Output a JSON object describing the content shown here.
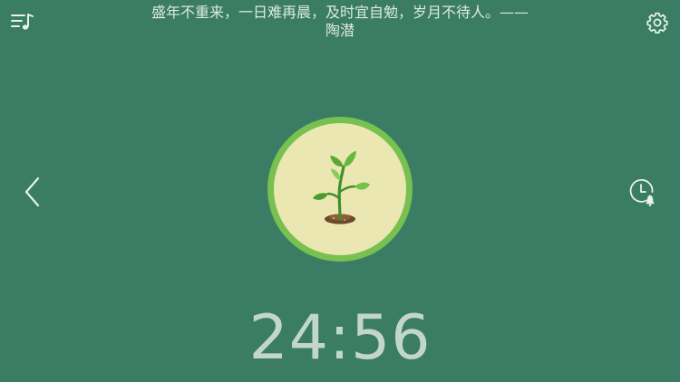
{
  "colors": {
    "background": "#3b7c64",
    "ring": "#78c04f",
    "circle_fill": "#ebe7b2",
    "icon": "#e6f2ec",
    "timer_text": "#c2d6cc"
  },
  "header": {
    "quote_line1": "盛年不重来，一日难再晨，及时宜自勉，岁月不待人。——",
    "quote_line2": "陶潜",
    "playlist_icon": "music-list-icon",
    "settings_icon": "gear-icon"
  },
  "nav": {
    "back_icon": "chevron-left-icon",
    "alarm_icon": "clock-bell-icon"
  },
  "plant": {
    "icon": "sapling-icon"
  },
  "timer": {
    "value": "24:56"
  }
}
